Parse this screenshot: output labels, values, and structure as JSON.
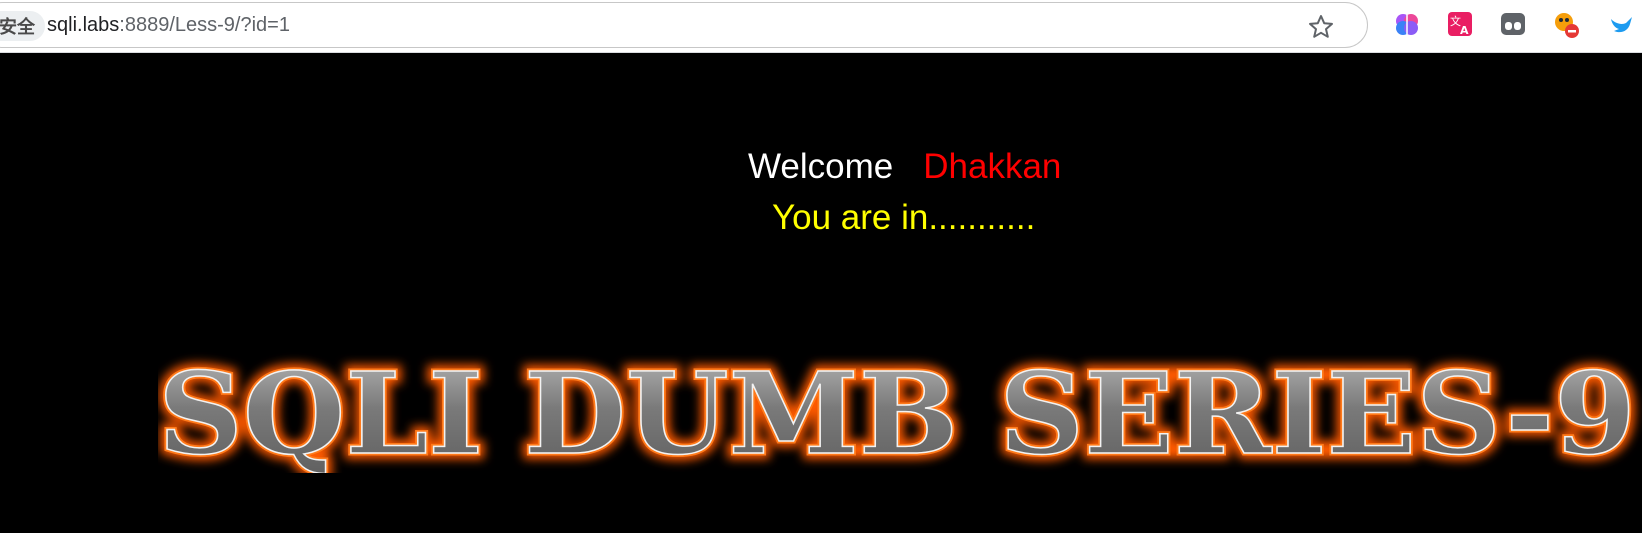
{
  "browser": {
    "security_label": "不安全",
    "url_host": "sqli.labs",
    "url_rest": ":8889/Less-9/?id=1",
    "icons": [
      "star-icon",
      "brain-extension-icon",
      "translate-extension-icon",
      "tab-extension-icon",
      "blocked-extension-icon",
      "bird-extension-icon"
    ]
  },
  "page": {
    "welcome": "Welcome",
    "user": "Dhakkan",
    "status": "You are in...........",
    "banner_title": "SQLI DUMB SERIES-9"
  },
  "colors": {
    "background": "#000000",
    "welcome": "#ffffff",
    "user": "#ff0000",
    "status": "#ffff00",
    "banner_glow": "#ff5a00",
    "banner_fill": "#8a8a8a"
  }
}
